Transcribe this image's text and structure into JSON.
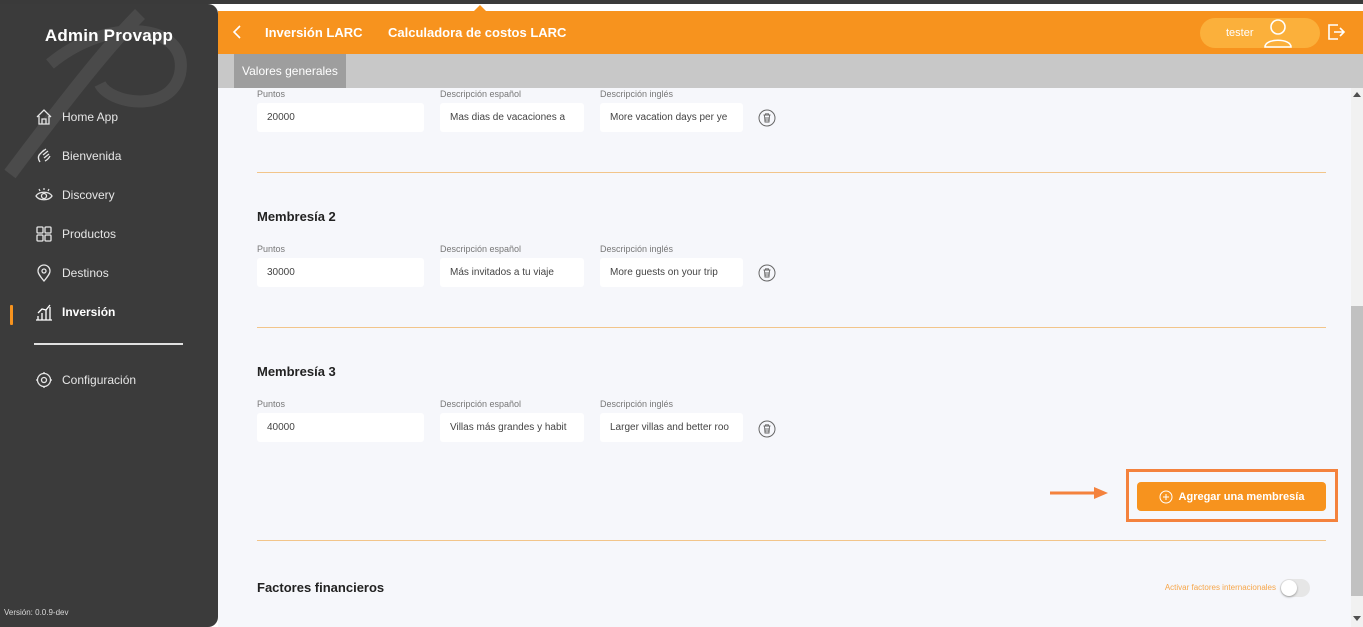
{
  "sidebar": {
    "brand": "Admin Provapp",
    "items": [
      {
        "label": "Home App",
        "icon": "home-icon"
      },
      {
        "label": "Bienvenida",
        "icon": "wave-hand-icon"
      },
      {
        "label": "Discovery",
        "icon": "eye-icon"
      },
      {
        "label": "Productos",
        "icon": "grid-icon"
      },
      {
        "label": "Destinos",
        "icon": "location-pin-icon"
      },
      {
        "label": "Inversión",
        "icon": "bar-chart-icon",
        "active": true
      },
      {
        "label": "Configuración",
        "icon": "gear-icon"
      }
    ],
    "version": "Versión: 0.0.9-dev"
  },
  "header": {
    "crumb1": "Inversión LARC",
    "crumb2": "Calculadora de costos LARC",
    "user": "tester"
  },
  "subbar": {
    "tab": "Valores generales"
  },
  "memberships": [
    {
      "title": "",
      "label_points": "Puntos",
      "label_es": "Descripción español",
      "label_en": "Descripción inglés",
      "points": "20000",
      "desc_es": "Mas dias de vacaciones a",
      "desc_en": "More vacation days per ye"
    },
    {
      "title": "Membresía 2",
      "label_points": "Puntos",
      "label_es": "Descripción español",
      "label_en": "Descripción inglés",
      "points": "30000",
      "desc_es": "Más invitados a tu viaje",
      "desc_en": "More guests on your trip"
    },
    {
      "title": "Membresía 3",
      "label_points": "Puntos",
      "label_es": "Descripción español",
      "label_en": "Descripción inglés",
      "points": "40000",
      "desc_es": "Villas más grandes y habit",
      "desc_en": "Larger villas and better roo"
    }
  ],
  "add_button": "Agregar una membresía",
  "financial": {
    "title": "Factores financieros",
    "toggle_label": "Activar factores internacionales",
    "toggle_on": false
  },
  "colors": {
    "accent": "#f7931e",
    "sidebar_bg": "#3b3b3b",
    "highlight": "#f4823d"
  }
}
